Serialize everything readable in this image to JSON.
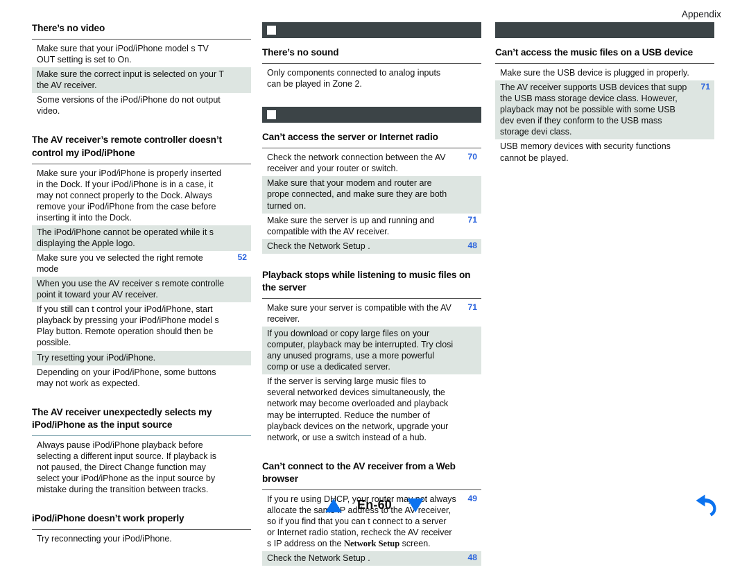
{
  "running_head": "Appendix",
  "footer": {
    "prev_label": "previous-page-triangle",
    "page_label": "En-60",
    "next_label": "next-page-triangle",
    "back_label": "back-arrow",
    "accent_color": "#0b72ef"
  },
  "theme": {
    "bar_color": "#3c4447",
    "shade_color": "#dde5e1",
    "ref_color": "#2a63dd",
    "rule_color": "#4f4f4f",
    "rule_teal": "#6d98a4"
  },
  "columns": [
    {
      "name": "left",
      "blocks": [
        {
          "type": "qa",
          "heading": "There’s no video",
          "rule": "dark",
          "rows": [
            {
              "text": "Make sure that your iPod/iPhone model s TV OUT setting is set to On.",
              "ref": "",
              "shaded": false
            },
            {
              "text": "Make sure the correct input is selected on your T the AV receiver.",
              "ref": "",
              "shaded": true
            },
            {
              "text": "Some versions of the iPod/iPhone do not output video.",
              "ref": "",
              "shaded": false
            }
          ]
        },
        {
          "type": "qa",
          "heading": "The AV receiver’s remote controller doesn’t control my iPod/iPhone",
          "rule": "dark",
          "rows": [
            {
              "text": "Make sure your iPod/iPhone is properly inserted in the Dock. If your iPod/iPhone is in a case, it may not connect properly to the Dock. Always remove your iPod/iPhone from the case before inserting it into the Dock.",
              "ref": "",
              "shaded": false
            },
            {
              "text": "The iPod/iPhone cannot be operated while it s displaying the Apple logo.",
              "ref": "",
              "shaded": true
            },
            {
              "text": "Make sure you ve selected the right remote mode",
              "ref": "52",
              "shaded": false
            },
            {
              "text": "When you use the AV receiver s remote controlle point it toward your AV receiver.",
              "ref": "",
              "shaded": true
            },
            {
              "text": "If you still can t control your iPod/iPhone, start playback by pressing your iPod/iPhone model s Play button. Remote operation should then be possible.",
              "ref": "",
              "shaded": false
            },
            {
              "text": "Try resetting your iPod/iPhone.",
              "ref": "",
              "shaded": true
            },
            {
              "text": "Depending on your iPod/iPhone, some buttons may not work as expected.",
              "ref": "",
              "shaded": false
            }
          ]
        },
        {
          "type": "qa",
          "heading": "The AV receiver unexpectedly selects my iPod/iPhone as the input source",
          "rule": "teal",
          "rows": [
            {
              "text": "Always pause iPod/iPhone playback before selecting a different input source. If playback is not paused, the Direct Change function may select your iPod/iPhone as the input source by mistake during the transition between tracks.",
              "ref": "",
              "shaded": false
            }
          ]
        },
        {
          "type": "qa",
          "heading": "iPod/iPhone doesn’t work properly",
          "rule": "dark",
          "rows": [
            {
              "text": "Try reconnecting your iPod/iPhone.",
              "ref": "",
              "shaded": false
            }
          ]
        }
      ]
    },
    {
      "name": "middle",
      "blocks": [
        {
          "type": "bar",
          "icon": "white-square"
        },
        {
          "type": "qa",
          "heading": "There’s no sound",
          "rule": "dark",
          "rows": [
            {
              "text": "Only components connected to analog inputs can be played in Zone 2.",
              "ref": "",
              "shaded": false
            }
          ]
        },
        {
          "type": "bar",
          "icon": "white-square"
        },
        {
          "type": "qa",
          "heading": "Can’t access the server or Internet radio",
          "rule": "dark",
          "rows": [
            {
              "text": "Check the network connection between the AV receiver and your router or switch.",
              "ref": "70",
              "shaded": false
            },
            {
              "text": "Make sure that your modem and router are prope connected, and make sure they are both turned on.",
              "ref": "",
              "shaded": true
            },
            {
              "text": "Make sure the server is up and running and compatible with the AV receiver.",
              "ref": "71",
              "shaded": false
            },
            {
              "text": "Check the  Network Setup .",
              "ref": "48",
              "shaded": true
            }
          ]
        },
        {
          "type": "qa",
          "heading": "Playback stops while listening to music files on the server",
          "rule": "dark",
          "rows": [
            {
              "text": "Make sure your server is compatible with the AV receiver.",
              "ref": "71",
              "shaded": false
            },
            {
              "text": "If you download or copy large files on your computer, playback may be interrupted. Try closi any unused programs, use a more powerful comp or use a dedicated server.",
              "ref": "",
              "shaded": true
            },
            {
              "text": "If the server is serving large music files to several networked devices simultaneously, the network may become overloaded and playback may be interrupted. Reduce the number of playback devices on the network, upgrade your network, or use a switch instead of a hub.",
              "ref": "",
              "shaded": false
            }
          ]
        },
        {
          "type": "qa",
          "heading": "Can’t connect to the AV receiver from a Web browser",
          "rule": "dark",
          "rows": [
            {
              "text": "If you re using DHCP, your router may not always allocate the same IP address to the AV receiver, so if you find that you can t connect to a server or Internet radio station, recheck the AV receiver s IP address on the ",
              "text_menu": "Network Setup",
              "text_tail": " screen.",
              "ref": "49",
              "shaded": false
            },
            {
              "text": "Check the  Network Setup .",
              "ref": "48",
              "shaded": true
            }
          ]
        }
      ]
    },
    {
      "name": "right",
      "blocks": [
        {
          "type": "bar",
          "icon": "none"
        },
        {
          "type": "qa",
          "heading": "Can’t access the music files on a USB device",
          "rule": "dark",
          "rows": [
            {
              "text": "Make sure the USB device is plugged in properly.",
              "ref": "",
              "shaded": false
            },
            {
              "text": "The AV receiver supports USB devices that supp the USB mass storage device class. However, playback may not be possible with some USB dev even if they conform to the USB mass storage devi class.",
              "ref": "71",
              "shaded": true
            },
            {
              "text": "USB memory devices with security functions cannot be played.",
              "ref": "",
              "shaded": false
            }
          ]
        }
      ]
    }
  ]
}
